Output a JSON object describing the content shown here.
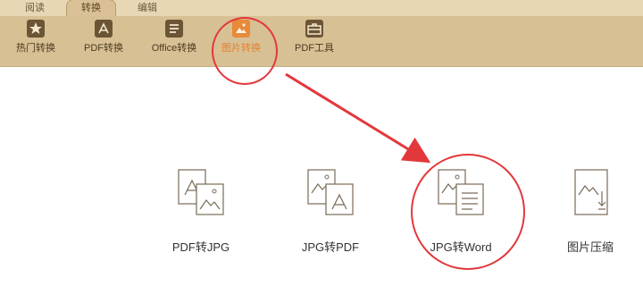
{
  "tabs": [
    "阅读",
    "转换",
    "编辑"
  ],
  "toolbar": {
    "items": [
      {
        "label": "热门转换",
        "icon": "star-icon"
      },
      {
        "label": "PDF转换",
        "icon": "pdf-icon"
      },
      {
        "label": "Office转换",
        "icon": "document-icon"
      },
      {
        "label": "图片转换",
        "icon": "image-icon",
        "active": true
      },
      {
        "label": "PDF工具",
        "icon": "toolbox-icon"
      }
    ]
  },
  "features": [
    {
      "label": "PDF转JPG"
    },
    {
      "label": "JPG转PDF"
    },
    {
      "label": "JPG转Word"
    },
    {
      "label": "图片压缩"
    }
  ],
  "colors": {
    "accent": "#e5802e",
    "annotation": "#e2383c",
    "toolbar": "#d8c095"
  }
}
